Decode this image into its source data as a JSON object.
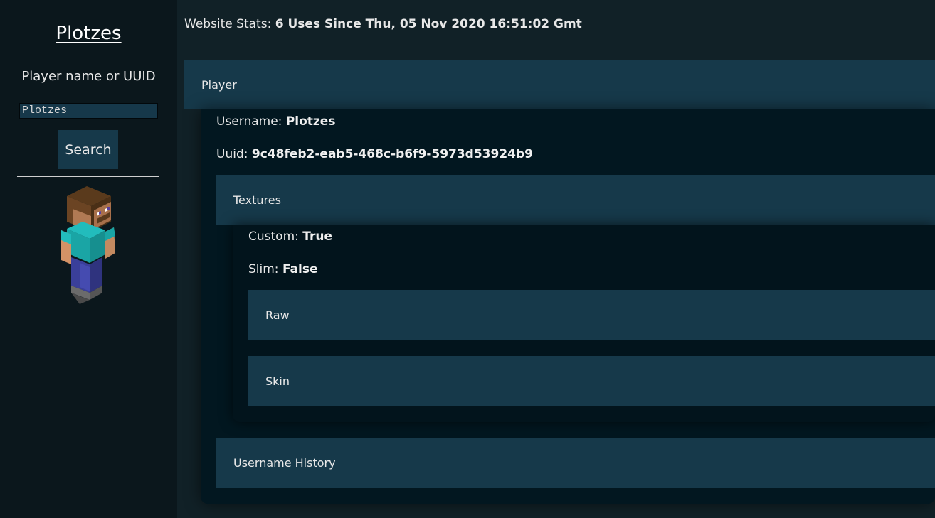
{
  "sidebar": {
    "title": "Plotzes",
    "search_label": "Player name or UUID",
    "search_value": "Plotzes",
    "search_button": "Search",
    "skin_icon": "player-skin-render"
  },
  "stats": {
    "label": "Website Stats:",
    "value": "6 Uses Since Thu, 05 Nov 2020 16:51:02 Gmt"
  },
  "player": {
    "header": "Player",
    "username_label": "Username:",
    "username_value": "Plotzes",
    "uuid_label": "Uuid:",
    "uuid_value": "9c48feb2-eab5-468c-b6f9-5973d53924b9",
    "textures": {
      "header": "Textures",
      "custom_label": "Custom:",
      "custom_value": "True",
      "slim_label": "Slim:",
      "slim_value": "False",
      "raw_header": "Raw",
      "skin_header": "Skin"
    },
    "history_header": "Username History"
  },
  "colors": {
    "sidebar_bg": "#0b171c",
    "main_bg": "#112127",
    "panel_header": "#16394a",
    "panel_body": "#021720"
  }
}
